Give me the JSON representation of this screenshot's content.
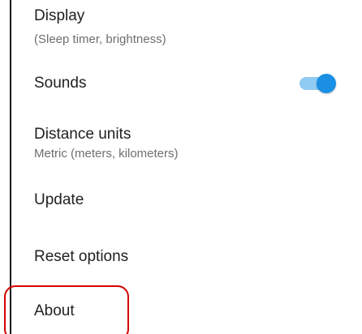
{
  "settings": {
    "items": [
      {
        "title": "Display",
        "subtitle": "(Sleep timer, brightness)"
      },
      {
        "title": "Sounds",
        "toggle_on": true
      },
      {
        "title": "Distance units",
        "subtitle": "Metric (meters, kilometers)"
      },
      {
        "title": "Update"
      },
      {
        "title": "Reset options"
      },
      {
        "title": "About"
      }
    ]
  },
  "colors": {
    "toggle_thumb": "#1a8fe3",
    "toggle_track": "#8fcbf2",
    "highlight": "#d40000"
  }
}
